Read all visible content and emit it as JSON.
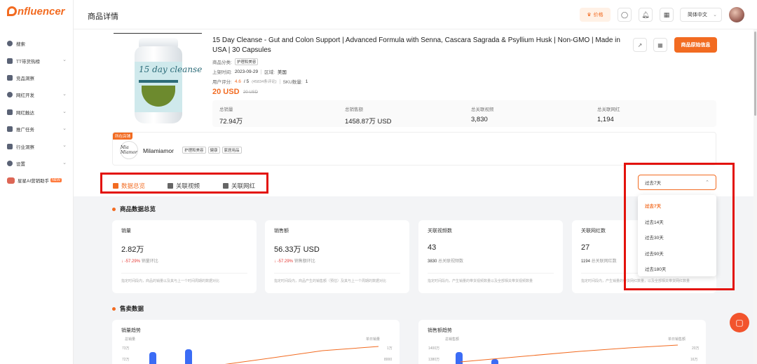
{
  "brand": {
    "name": "nfluencer"
  },
  "sidebar": {
    "items": [
      {
        "label": "搜索",
        "icon": "compass-icon",
        "has_chevron": false
      },
      {
        "label": "TT带货热榜",
        "icon": "bar-chart-icon",
        "has_chevron": true
      },
      {
        "label": "竞品洞察",
        "icon": "shield-icon",
        "has_chevron": false
      },
      {
        "label": "网红开发",
        "icon": "heart-icon",
        "has_chevron": true
      },
      {
        "label": "网红触达",
        "icon": "mail-icon",
        "has_chevron": true
      },
      {
        "label": "推广任务",
        "icon": "task-icon",
        "has_chevron": true
      },
      {
        "label": "行业洞察",
        "icon": "monitor-icon",
        "has_chevron": true
      },
      {
        "label": "设置",
        "icon": "gear-icon",
        "has_chevron": true
      }
    ],
    "ai_item": {
      "label": "星星AI营销助手",
      "badge": "NEW"
    }
  },
  "topbar": {
    "title": "商品详情",
    "price_label": "价格",
    "language": "简体中文"
  },
  "product": {
    "name": "15 Day Cleanse - Gut and Colon Support | Advanced Formula with Senna, Cascara Sagrada & Psyllium Husk | Non-GMO | Made in USA | 30 Capsules",
    "category_label": "商品分类:",
    "category": "护理和美容",
    "listed_label": "上架时间:",
    "listed_date": "2023-09-29",
    "region_label": "区域:",
    "region": "美国",
    "rating_label": "用户评分:",
    "rating": "4.6",
    "rating_max": "/ 5",
    "rating_count": "(45834条评论)",
    "sku_label": "SKU数量:",
    "sku_count": "1",
    "price": "20 USD",
    "original_price": "20 USD",
    "original_info_button": "商品原始信息",
    "image_text": "15 day cleanse"
  },
  "stats": [
    {
      "label": "总销量",
      "value": "72.94万"
    },
    {
      "label": "总销售额",
      "value": "1458.87万 USD"
    },
    {
      "label": "总关联视频",
      "value": "3,830"
    },
    {
      "label": "总关联网红",
      "value": "1,194"
    }
  ],
  "shop": {
    "badge": "所在店铺",
    "logo_text": "Mia Miamor",
    "name": "Milamiamor",
    "tags": [
      "护理和美容",
      "健康",
      "家居用品"
    ]
  },
  "tabs": [
    {
      "label": "数据总览",
      "active": true
    },
    {
      "label": "关联视频",
      "active": false
    },
    {
      "label": "关联网红",
      "active": false
    }
  ],
  "range_filter": {
    "selected": "过去7天",
    "options": [
      "过去7天",
      "过去14天",
      "过去30天",
      "过去90天",
      "过去180天"
    ]
  },
  "overview": {
    "title": "商品数据总览",
    "cards": [
      {
        "label": "销量",
        "value": "2.82万",
        "sub_value": "↓ -57.29%",
        "sub_label": "销量环比",
        "note": "指定时间段内，商品的销量以及其与上一个时间周期的数据对比"
      },
      {
        "label": "销售额",
        "value": "56.33万 USD",
        "sub_value": "↓ -57.29%",
        "sub_label": "销售额环比",
        "note": "指定时间段内，商品产生的销售额（预估）及其与上一个周期的数据对比"
      },
      {
        "label": "关联视频数",
        "value": "43",
        "sub_value": "3830",
        "sub_label": "总关联视频数",
        "note": "指定时间段内，产生销量的带货视频数量以及全部相关带货视频数量"
      },
      {
        "label": "关联网红数",
        "value": "27",
        "sub_value": "1194",
        "sub_label": "总关联网红数",
        "note": "指定时间段内，产生销量的带货网红数量，以及全部相关带货网红数量"
      }
    ]
  },
  "sales": {
    "title": "售卖数据",
    "charts": [
      {
        "title": "销量趋势",
        "left_axis_label": "总销量",
        "right_axis_label": "单日销量",
        "left_ticks": [
          "73万",
          "72万"
        ],
        "right_ticks": [
          "1万",
          "8000"
        ]
      },
      {
        "title": "销售额趋势",
        "left_axis_label": "总销售额",
        "right_axis_label": "单日销售额",
        "left_ticks": [
          "1400万",
          "1380万"
        ],
        "right_ticks": [
          "20万",
          "16万"
        ]
      }
    ]
  },
  "colors": {
    "accent": "#f26b21",
    "highlight_box": "#e3120b",
    "down": "#e53935",
    "bar": "#3b6cf5"
  }
}
